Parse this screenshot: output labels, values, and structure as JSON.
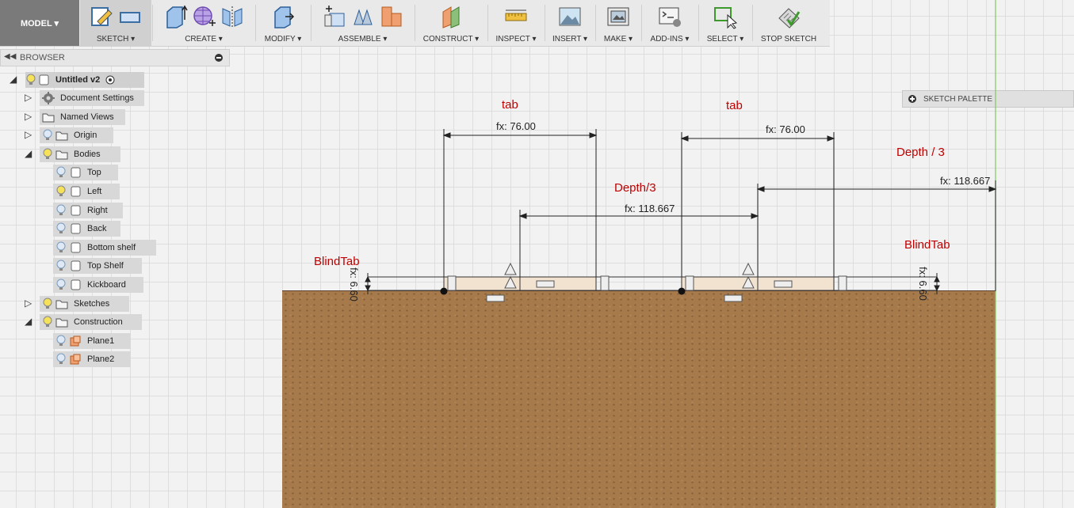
{
  "toolbar": {
    "model_label": "MODEL ▾",
    "groups": [
      {
        "label": "SKETCH ▾"
      },
      {
        "label": "CREATE ▾"
      },
      {
        "label": "MODIFY ▾"
      },
      {
        "label": "ASSEMBLE ▾"
      },
      {
        "label": "CONSTRUCT ▾"
      },
      {
        "label": "INSPECT ▾"
      },
      {
        "label": "INSERT ▾"
      },
      {
        "label": "MAKE ▾"
      },
      {
        "label": "ADD-INS ▾"
      },
      {
        "label": "SELECT ▾"
      },
      {
        "label": "STOP SKETCH"
      }
    ]
  },
  "browser": {
    "title": "BROWSER",
    "root": "Untitled v2",
    "items": [
      {
        "label": "Document Settings"
      },
      {
        "label": "Named Views"
      },
      {
        "label": "Origin"
      },
      {
        "label": "Bodies"
      },
      {
        "label": "Top"
      },
      {
        "label": "Left"
      },
      {
        "label": "Right"
      },
      {
        "label": "Back"
      },
      {
        "label": "Bottom shelf"
      },
      {
        "label": "Top Shelf"
      },
      {
        "label": "Kickboard"
      },
      {
        "label": "Sketches"
      },
      {
        "label": "Construction"
      },
      {
        "label": "Plane1"
      },
      {
        "label": "Plane2"
      }
    ]
  },
  "palette": {
    "label": "SKETCH PALETTE"
  },
  "annotations": {
    "tab1": "tab",
    "tab2": "tab",
    "depth1": "Depth/3",
    "depth2": "Depth / 3",
    "blind1": "BlindTab",
    "blind2": "BlindTab"
  },
  "dimensions": {
    "d1": "fx: 76.00",
    "d2": "fx: 76.00",
    "d3": "fx: 118.667",
    "d4": "fx: 118.667",
    "d5": "fx: 6.60",
    "d6": "fx: 6.60"
  },
  "colors": {
    "annotation": "#c00000",
    "board": "#a67a4b",
    "tab_fill": "#f2e2d0"
  }
}
